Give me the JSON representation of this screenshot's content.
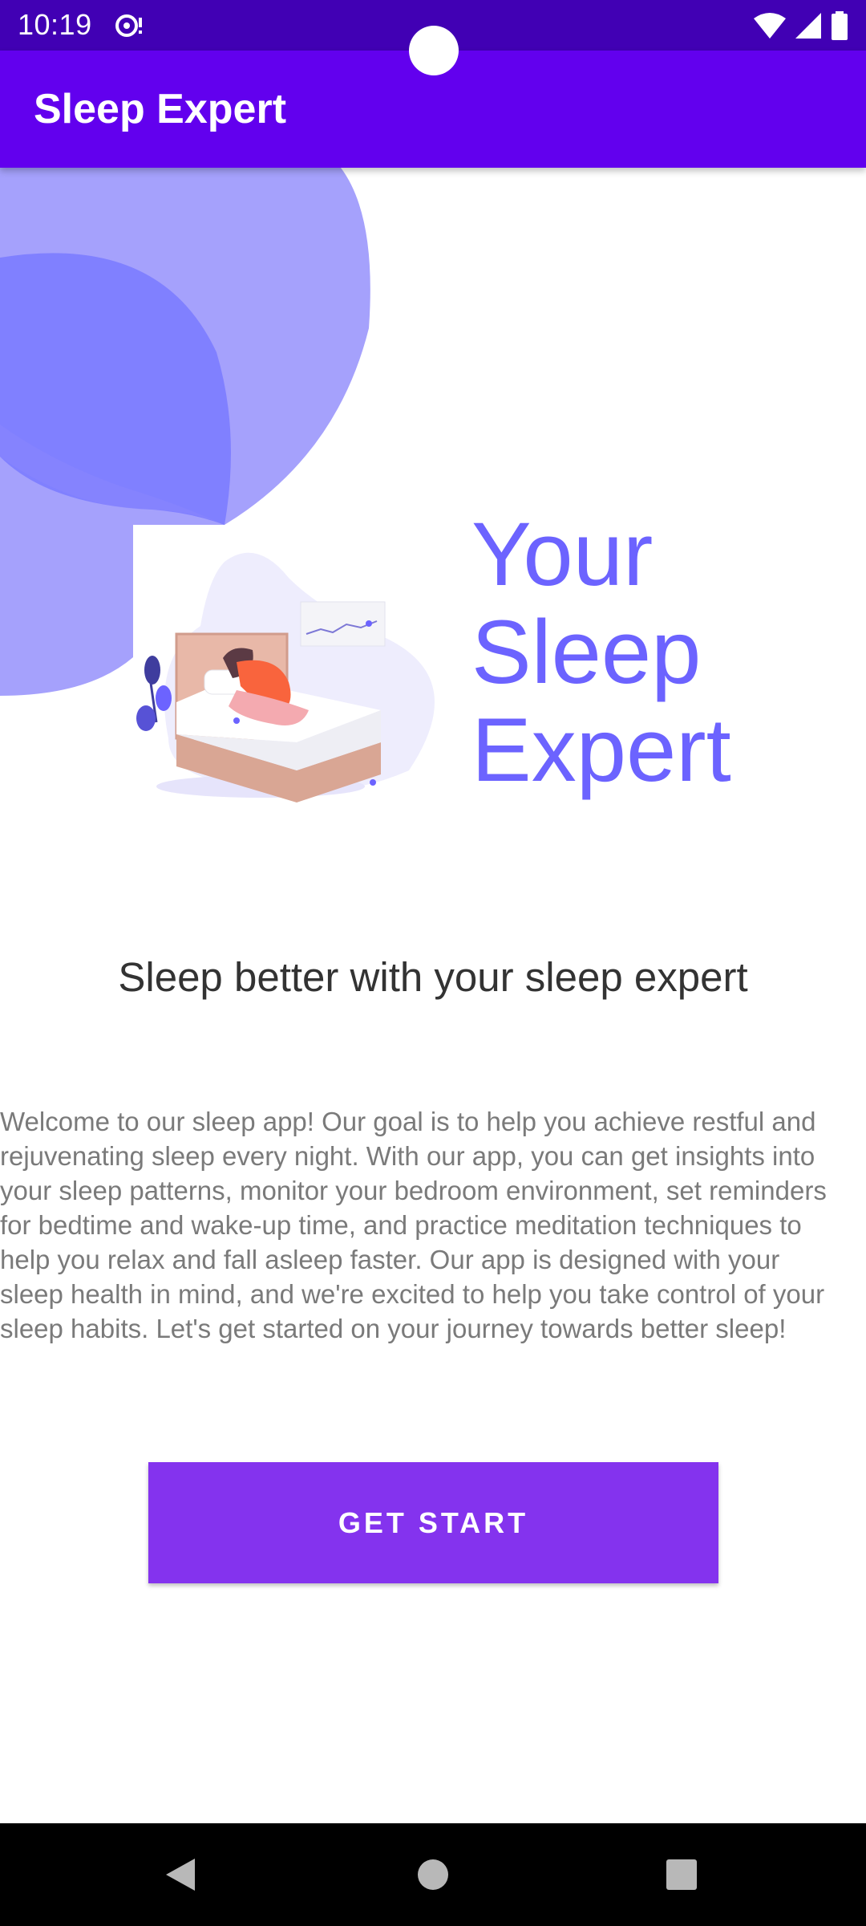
{
  "status_bar": {
    "time": "10:19",
    "notification_icon": "sync-alert-icon",
    "wifi_icon": "wifi-icon",
    "signal_icon": "cellular-signal-icon",
    "battery_icon": "battery-icon",
    "background_color": "#4100b4"
  },
  "app_bar": {
    "title": "Sleep Expert",
    "background_color": "#6200ee"
  },
  "hero": {
    "title_line_1": "Your",
    "title_line_2": "Sleep",
    "title_line_3": "Expert",
    "title_color": "#6c63ff",
    "illustration": "person-sleeping-in-bed-illustration"
  },
  "subtitle": "Sleep better with your sleep expert",
  "description": "Welcome to our sleep app! Our goal is to help you achieve restful and rejuvenating sleep every night. With our app, you can get insights into your sleep patterns, monitor your bedroom environment, set reminders for bedtime and wake-up time, and practice meditation techniques to help you relax and fall asleep faster. Our app is designed with your sleep health in mind, and we're excited to help you take control of your sleep habits. Let's get started on your journey towards better sleep!",
  "cta": {
    "label": "GET START",
    "color": "#8433ee"
  },
  "nav_bar": {
    "back_icon": "back-triangle-icon",
    "home_icon": "home-circle-icon",
    "recents_icon": "recents-square-icon"
  }
}
